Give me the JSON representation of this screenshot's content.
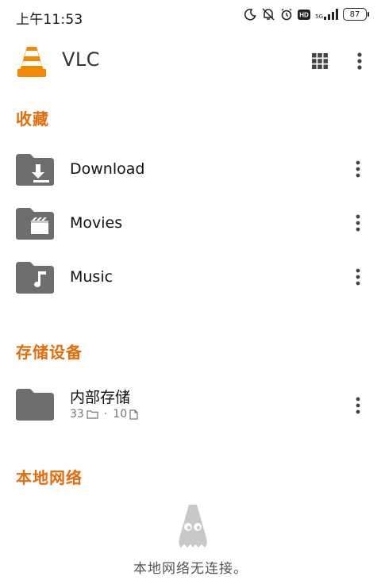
{
  "status_bar": {
    "time": "上午11:53",
    "network_label": "5G",
    "battery": "87"
  },
  "app_bar": {
    "title": "VLC"
  },
  "favorites": {
    "title": "收藏",
    "items": [
      {
        "label": "Download",
        "icon": "download-folder-icon"
      },
      {
        "label": "Movies",
        "icon": "movie-folder-icon"
      },
      {
        "label": "Music",
        "icon": "music-folder-icon"
      }
    ]
  },
  "storage": {
    "title": "存储设备",
    "items": [
      {
        "label": "内部存储",
        "folder_count": "33",
        "separator": "·",
        "file_count": "10"
      }
    ]
  },
  "local_network": {
    "title": "本地网络",
    "empty_message": "本地网络无连接。"
  },
  "colors": {
    "accent": "#e46c0a",
    "folder": "#6e6e6e",
    "empty_icon": "#c8c8c8"
  }
}
